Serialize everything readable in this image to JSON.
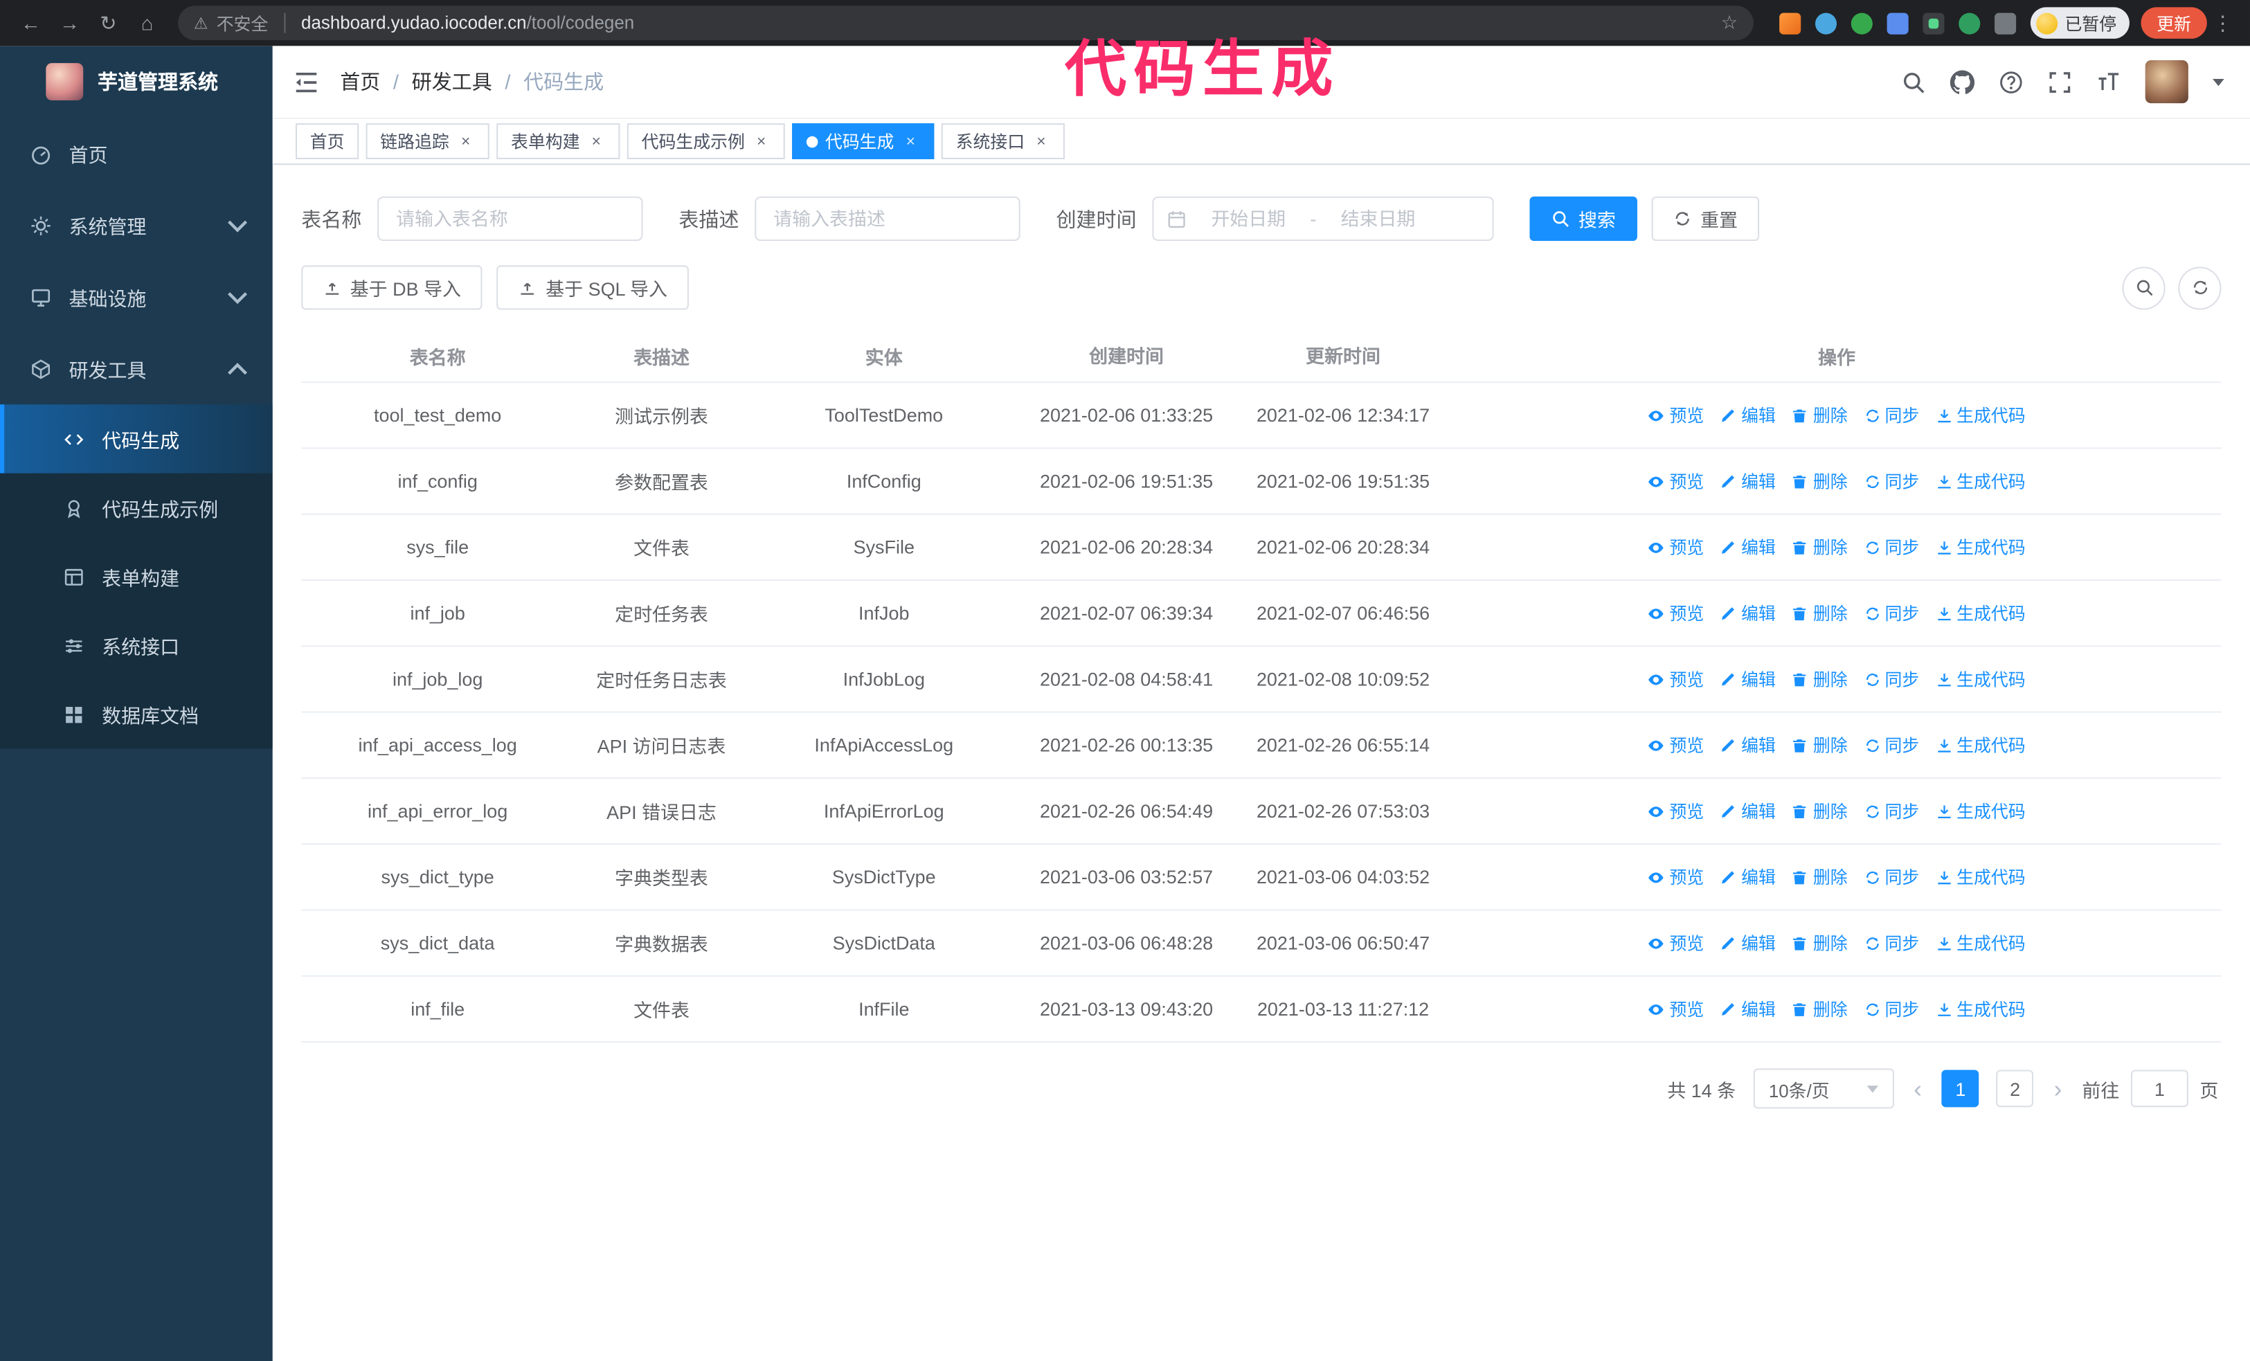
{
  "browser": {
    "back_icon": "←",
    "forward_icon": "→",
    "refresh_icon": "↻",
    "home_icon": "⌂",
    "warning_icon": "⚠",
    "security_label": "不安全",
    "url_host": "dashboard.yudao.iocoder.cn",
    "url_path": "/tool/codegen",
    "star_icon": "☆",
    "menu_icon": "⋮",
    "paused_badge": "已暂停",
    "update_button": "更新"
  },
  "annotation": "代码生成",
  "sidebar": {
    "logo_title": "芋道管理系统",
    "items": [
      {
        "label": "首页",
        "icon": "dashboard-icon"
      },
      {
        "label": "系统管理",
        "icon": "gear-icon"
      },
      {
        "label": "基础设施",
        "icon": "monitor-icon"
      },
      {
        "label": "研发工具",
        "icon": "toolbox-icon"
      }
    ],
    "sub_items": [
      {
        "label": "代码生成",
        "icon": "code-icon",
        "active": true
      },
      {
        "label": "代码生成示例",
        "icon": "medal-icon"
      },
      {
        "label": "表单构建",
        "icon": "form-icon"
      },
      {
        "label": "系统接口",
        "icon": "api-icon"
      },
      {
        "label": "数据库文档",
        "icon": "database-icon"
      }
    ]
  },
  "navbar": {
    "breadcrumb": [
      "首页",
      "研发工具",
      "代码生成"
    ],
    "breadcrumb_separator": "/"
  },
  "tabs": [
    {
      "label": "首页",
      "closable": false
    },
    {
      "label": "链路追踪",
      "closable": true
    },
    {
      "label": "表单构建",
      "closable": true
    },
    {
      "label": "代码生成示例",
      "closable": true
    },
    {
      "label": "代码生成",
      "closable": true,
      "active": true
    },
    {
      "label": "系统接口",
      "closable": true
    }
  ],
  "ui": {
    "close_icon": "×"
  },
  "filters": {
    "table_name_label": "表名称",
    "table_name_placeholder": "请输入表名称",
    "table_desc_label": "表描述",
    "table_desc_placeholder": "请输入表描述",
    "create_time_label": "创建时间",
    "date_start_placeholder": "开始日期",
    "date_separator": "-",
    "date_end_placeholder": "结束日期",
    "search_button": "搜索",
    "reset_button": "重置"
  },
  "toolbar": {
    "import_db_button": "基于 DB 导入",
    "import_sql_button": "基于 SQL 导入"
  },
  "table": {
    "columns": [
      "表名称",
      "表描述",
      "实体",
      "创建时间",
      "更新时间",
      "操作"
    ],
    "actions": [
      "预览",
      "编辑",
      "删除",
      "同步",
      "生成代码"
    ],
    "rows": [
      {
        "name": "tool_test_demo",
        "desc": "测试示例表",
        "entity": "ToolTestDemo",
        "created": "2021-02-06 01:33:25",
        "updated": "2021-02-06 12:34:17"
      },
      {
        "name": "inf_config",
        "desc": "参数配置表",
        "entity": "InfConfig",
        "created": "2021-02-06 19:51:35",
        "updated": "2021-02-06 19:51:35"
      },
      {
        "name": "sys_file",
        "desc": "文件表",
        "entity": "SysFile",
        "created": "2021-02-06 20:28:34",
        "updated": "2021-02-06 20:28:34"
      },
      {
        "name": "inf_job",
        "desc": "定时任务表",
        "entity": "InfJob",
        "created": "2021-02-07 06:39:34",
        "updated": "2021-02-07 06:46:56"
      },
      {
        "name": "inf_job_log",
        "desc": "定时任务日志表",
        "entity": "InfJobLog",
        "created": "2021-02-08 04:58:41",
        "updated": "2021-02-08 10:09:52"
      },
      {
        "name": "inf_api_access_log",
        "desc": "API 访问日志表",
        "entity": "InfApiAccessLog",
        "created": "2021-02-26 00:13:35",
        "updated": "2021-02-26 06:55:14"
      },
      {
        "name": "inf_api_error_log",
        "desc": "API 错误日志",
        "entity": "InfApiErrorLog",
        "created": "2021-02-26 06:54:49",
        "updated": "2021-02-26 07:53:03"
      },
      {
        "name": "sys_dict_type",
        "desc": "字典类型表",
        "entity": "SysDictType",
        "created": "2021-03-06 03:52:57",
        "updated": "2021-03-06 04:03:52"
      },
      {
        "name": "sys_dict_data",
        "desc": "字典数据表",
        "entity": "SysDictData",
        "created": "2021-03-06 06:48:28",
        "updated": "2021-03-06 06:50:47"
      },
      {
        "name": "inf_file",
        "desc": "文件表",
        "entity": "InfFile",
        "created": "2021-03-13 09:43:20",
        "updated": "2021-03-13 11:27:12"
      }
    ]
  },
  "pagination": {
    "total_text": "共 14 条",
    "page_size_text": "10条/页",
    "prev_icon": "‹",
    "next_icon": "›",
    "pages": [
      "1",
      "2"
    ],
    "active_page": "1",
    "goto_label": "前往",
    "goto_value": "1",
    "goto_unit": "页"
  },
  "colors": {
    "accent": "#1890ff",
    "sidebar_bg": "#1d3a50",
    "submenu_bg": "#162e3e",
    "annotation": "#fa2d6b",
    "chrome_bg": "#202124"
  }
}
